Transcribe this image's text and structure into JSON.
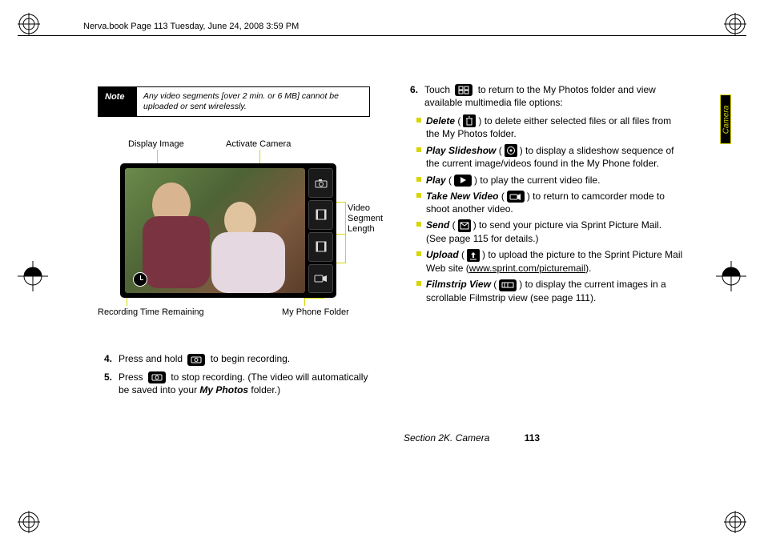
{
  "header": "Nerva.book  Page 113  Tuesday, June 24, 2008  3:59 PM",
  "side_tab": "Camera",
  "note": {
    "label": "Note",
    "text": "Any video segments [over 2 min. or 6 MB] cannot be uploaded or sent wirelessly."
  },
  "diagram": {
    "display_image": "Display Image",
    "activate_camera": "Activate Camera",
    "video_segment_length": "Video\nSegment\nLength",
    "recording_time": "Recording Time\nRemaining",
    "my_phone_folder": "My Phone\nFolder"
  },
  "steps_left": [
    {
      "n": "4.",
      "pre": "Press and hold ",
      "post": " to begin recording."
    },
    {
      "n": "5.",
      "pre": "Press ",
      "mid": " to stop recording. (The video will automatically be saved into your ",
      "em": "My Photos",
      "post2": " folder.)"
    }
  ],
  "step6": {
    "n": "6.",
    "pre": "Touch ",
    "post": " to return to the My Photos folder and view available multimedia file options:"
  },
  "opts": [
    {
      "name": "Delete",
      "text": ") to delete either selected files or all files from the My Photos folder.",
      "icon": "trash"
    },
    {
      "name": "Play Slideshow",
      "text": ") to display a slideshow sequence of the current image/videos found in the My Phone folder.",
      "icon": "circle"
    },
    {
      "name": "Play",
      "text": ") to play the current video file.",
      "icon": "play"
    },
    {
      "name": "Take New Video",
      "text": ") to return to camcorder mode to shoot another video.",
      "icon": "vid"
    },
    {
      "name": "Send",
      "text_a": ") to send your picture via Sprint Picture Mail. (See page 115 for details.)",
      "icon": "mail"
    },
    {
      "name": "Upload",
      "text_a": ") to upload the picture to the Sprint Picture Mail Web site (",
      "link": "www.sprint.com/picturemail",
      "text_b": ").",
      "icon": "up"
    },
    {
      "name": "Filmstrip View",
      "text": ") to display the current images in a scrollable Filmstrip view (see page 111).",
      "icon": "film"
    }
  ],
  "footer": {
    "section": "Section 2K. Camera",
    "page": "113"
  }
}
